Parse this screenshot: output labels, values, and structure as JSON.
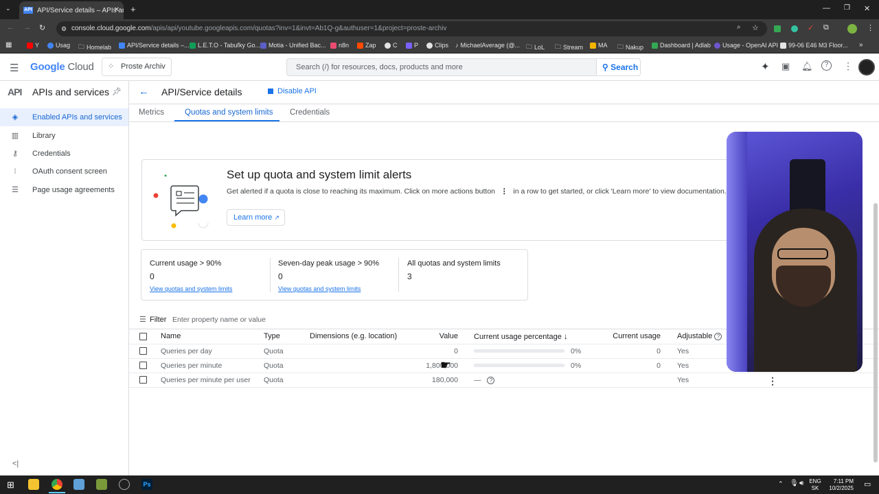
{
  "browser": {
    "tab_title": "API/Service details – APIs and s",
    "tab_favicon": "API",
    "url_host": "console.cloud.google.com",
    "url_path": "/apis/api/youtube.googleapis.com/quotas?inv=1&invt=Ab1Q-g&authuser=1&project=proste-archiv",
    "bookmarks": [
      {
        "label": "Y",
        "color": "#ff0000"
      },
      {
        "label": "Usag",
        "color": "#4285f4"
      },
      {
        "label": "Homelab",
        "color": "#9aa0a6"
      },
      {
        "label": "API/Service details –...",
        "color": "#4285f4"
      },
      {
        "label": "L.E.T.O - Tabuľky Go...",
        "color": "#0f9d58"
      },
      {
        "label": "Motia - Unified Bac...",
        "color": "#5b5fc7"
      },
      {
        "label": "n8n",
        "color": "#ea4b71"
      },
      {
        "label": "Zap",
        "color": "#ff4a00"
      },
      {
        "label": "C",
        "color": "#e3e3e3"
      },
      {
        "label": "P",
        "color": "#7b61ff"
      },
      {
        "label": "Clips",
        "color": "#e3e3e3"
      },
      {
        "label": "MichaelAverage (@...",
        "color": "#e3e3e3"
      },
      {
        "label": "LoL",
        "color": "#9aa0a6"
      },
      {
        "label": "Stream",
        "color": "#9aa0a6"
      },
      {
        "label": "MA",
        "color": "#f4b400"
      },
      {
        "label": "Nakup",
        "color": "#9aa0a6"
      },
      {
        "label": "Dashboard | Adlab",
        "color": "#34a853"
      },
      {
        "label": "Usage - OpenAI API",
        "color": "#6e56cf"
      },
      {
        "label": "99-06 E46 M3 Floor...",
        "color": "#e3e3e3"
      }
    ]
  },
  "header": {
    "logo_google": "Google",
    "logo_cloud": "Cloud",
    "project": "Proste Archiv",
    "search_placeholder": "Search (/) for resources, docs, products and more",
    "search_button": "Search"
  },
  "sidebar": {
    "title": "APIs and services",
    "items": [
      {
        "label": "Enabled APIs and services",
        "icon": "◈"
      },
      {
        "label": "Library",
        "icon": "▥"
      },
      {
        "label": "Credentials",
        "icon": "⚷"
      },
      {
        "label": "OAuth consent screen",
        "icon": "⁝"
      },
      {
        "label": "Page usage agreements",
        "icon": "☰"
      }
    ]
  },
  "page": {
    "title": "API/Service details",
    "disable_api": "Disable API",
    "tabs": [
      "Metrics",
      "Quotas and system limits",
      "Credentials"
    ]
  },
  "alert": {
    "title": "Set up quota and system limit alerts",
    "text_before": "Get alerted if a quota is close to reaching its maximum. Click on more actions button",
    "text_after": "in a row to get started, or click 'Learn more' to view documentation.",
    "learn_more": "Learn more"
  },
  "stats": [
    {
      "label": "Current usage > 90%",
      "value": "0",
      "link": "View quotas and system limits"
    },
    {
      "label": "Seven-day peak usage > 90%",
      "value": "0",
      "link": "View quotas and system limits"
    },
    {
      "label": "All quotas and system limits",
      "value": "3",
      "link": ""
    }
  ],
  "filter": {
    "label": "Filter",
    "placeholder": "Enter property name or value"
  },
  "table": {
    "columns": [
      "Name",
      "Type",
      "Dimensions (e.g. location)",
      "Value",
      "Current usage percentage",
      "Current usage",
      "Adjustable"
    ],
    "rows": [
      {
        "name": "Queries per day",
        "type": "Quota",
        "dimensions": "",
        "value": "0",
        "usage_pct": "0%",
        "current": "0",
        "adjustable": "Yes"
      },
      {
        "name": "Queries per minute",
        "type": "Quota",
        "dimensions": "",
        "value": "1,800,000",
        "usage_pct": "0%",
        "current": "0",
        "adjustable": "Yes"
      },
      {
        "name": "Queries per minute per user",
        "type": "Quota",
        "dimensions": "",
        "value": "180,000",
        "usage_pct": "—",
        "current": "",
        "adjustable": "Yes"
      }
    ]
  },
  "taskbar": {
    "lang1": "ENG",
    "lang2": "SK",
    "time": "7:11 PM",
    "date": "10/2/2025"
  }
}
